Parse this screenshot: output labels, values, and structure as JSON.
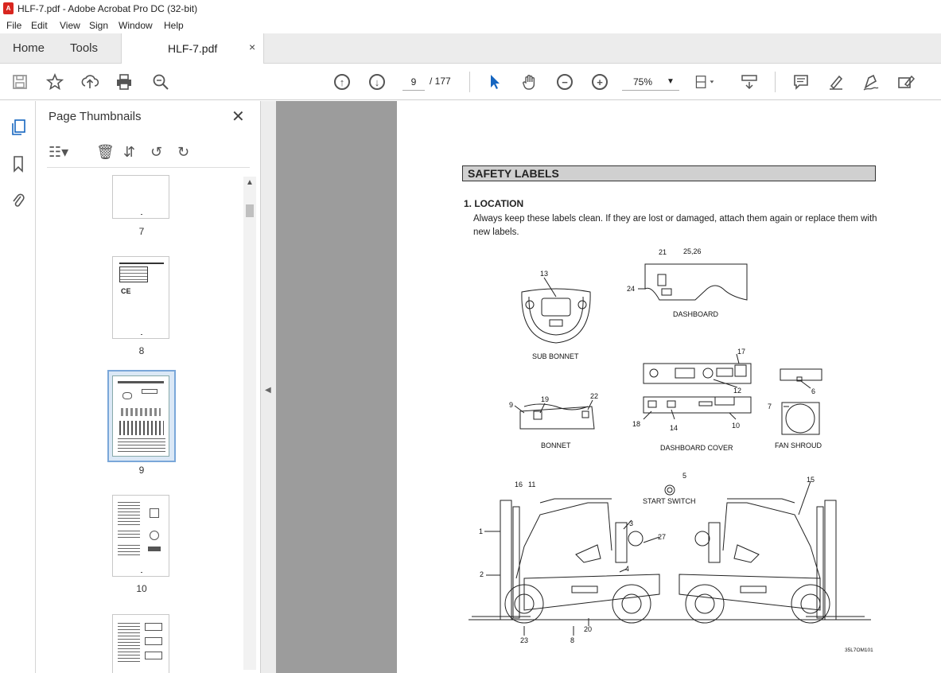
{
  "window": {
    "title": "HLF-7.pdf - Adobe Acrobat Pro DC (32-bit)"
  },
  "menu": [
    "File",
    "Edit",
    "View",
    "Sign",
    "Window",
    "Help"
  ],
  "tabs": {
    "home": "Home",
    "tools": "Tools",
    "document": "HLF-7.pdf",
    "close": "×"
  },
  "toolbar": {
    "current_page": "9",
    "total_pages": "/ 177",
    "zoom": "75%"
  },
  "panel": {
    "title": "Page Thumbnails",
    "thumbnails": [
      {
        "label": "7"
      },
      {
        "label": "8"
      },
      {
        "label": "9",
        "selected": true
      },
      {
        "label": "10"
      }
    ]
  },
  "document": {
    "heading": "SAFETY LABELS",
    "section": "1. LOCATION",
    "paragraph": "Always keep these labels clean.  If they are lost or damaged, attach them again or replace them with new labels.",
    "figure_labels": {
      "sub_bonnet": "SUB BONNET",
      "dashboard": "DASHBOARD",
      "bonnet": "BONNET",
      "dashboard_cover": "DASHBOARD COVER",
      "fan_shroud": "FAN SHROUD",
      "start_switch": "START SWITCH",
      "figure_code": "35L7OM101"
    },
    "callouts": [
      "13",
      "21",
      "25,26",
      "24",
      "17",
      "12",
      "6",
      "9",
      "19",
      "22",
      "18",
      "14",
      "10",
      "7",
      "5",
      "16",
      "11",
      "15",
      "1",
      "3",
      "27",
      "2",
      "4",
      "23",
      "8",
      "20"
    ]
  },
  "colors": {
    "accent_selection": "#7aa7d9",
    "doc_background": "#9c9c9c",
    "pdf_icon": "#d8261f"
  }
}
